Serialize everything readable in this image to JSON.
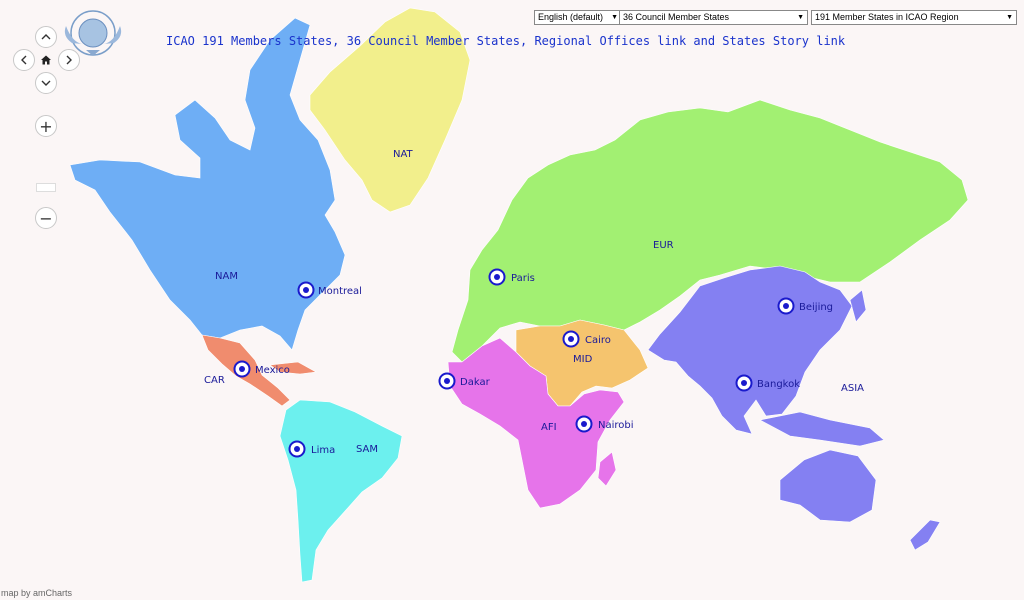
{
  "header": {
    "title": "ICAO 191 Members States, 36 Council Member States, Regional Offices link and States Story link"
  },
  "controls": {
    "language_select": "English (default)",
    "council_select": "36 Council Member States",
    "members_select": "191 Member States in ICAO Region"
  },
  "nav": {
    "up_icon": "chevron-up-icon",
    "left_icon": "chevron-left-icon",
    "home_icon": "home-icon",
    "right_icon": "chevron-right-icon",
    "down_icon": "chevron-down-icon",
    "zoom_in": "+",
    "zoom_out": "−"
  },
  "regions": [
    {
      "id": "NAT",
      "label": "NAT",
      "color": "#f2ef8c"
    },
    {
      "id": "NAM",
      "label": "NAM",
      "color": "#6eaef5"
    },
    {
      "id": "CAR",
      "label": "CAR",
      "color": "#f08c6e"
    },
    {
      "id": "SAM",
      "label": "SAM",
      "color": "#6cf0ee"
    },
    {
      "id": "EUR",
      "label": "EUR",
      "color": "#a2f072"
    },
    {
      "id": "MID",
      "label": "MID",
      "color": "#f5c46e"
    },
    {
      "id": "AFI",
      "label": "AFI",
      "color": "#e674ea"
    },
    {
      "id": "ASIA",
      "label": "ASIA",
      "color": "#8480f2"
    }
  ],
  "offices": [
    {
      "name": "Montreal"
    },
    {
      "name": "Paris"
    },
    {
      "name": "Cairo"
    },
    {
      "name": "Mexico"
    },
    {
      "name": "Dakar"
    },
    {
      "name": "Nairobi"
    },
    {
      "name": "Lima"
    },
    {
      "name": "Beijing"
    },
    {
      "name": "Bangkok"
    }
  ],
  "marker_color": "#1a1acc",
  "footer": {
    "credit": "map by amCharts"
  }
}
